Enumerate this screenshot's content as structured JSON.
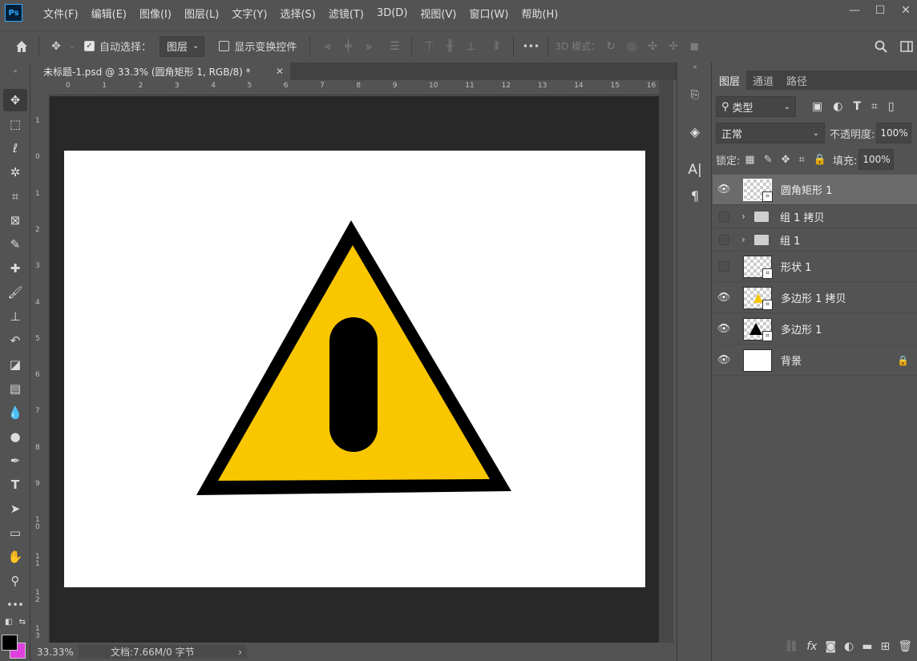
{
  "app": {
    "logo": "Ps"
  },
  "menu": [
    "文件(F)",
    "编辑(E)",
    "图像(I)",
    "图层(L)",
    "文字(Y)",
    "选择(S)",
    "滤镜(T)",
    "3D(D)",
    "视图(V)",
    "窗口(W)",
    "帮助(H)"
  ],
  "window_controls": {
    "minimize": "—",
    "maximize": "☐",
    "close": "✕"
  },
  "options": {
    "auto_select_label": "自动选择：",
    "auto_select_checked": true,
    "auto_select_target": "图层",
    "show_transform_label": "显示变换控件",
    "show_transform_checked": false,
    "more": "•••",
    "mode_3d_label": "3D 模式："
  },
  "document": {
    "tab_title": "未标题-1.psd @ 33.3% (圆角矩形 1, RGB/8) *",
    "colors": {
      "triangle_fill": "#f9c600",
      "triangle_stroke": "#000000",
      "pill": "#000000",
      "background": "#ffffff"
    }
  },
  "rulers": {
    "top": [
      "0",
      "1",
      "2",
      "3",
      "4",
      "5",
      "6",
      "7",
      "8",
      "9",
      "10",
      "11",
      "12",
      "13",
      "14",
      "15",
      "16"
    ],
    "left": [
      "1",
      "0",
      "1",
      "2",
      "3",
      "4",
      "5",
      "6",
      "7",
      "8",
      "9",
      "1 0",
      "1 1",
      "1 2",
      "1 3"
    ]
  },
  "status": {
    "zoom": "33.33%",
    "doc_info": "文档:7.66M/0 字节",
    "arrow": "›"
  },
  "layers_panel": {
    "tabs": [
      "图层",
      "通道",
      "路径"
    ],
    "active_tab": "图层",
    "filter": {
      "kind_label": "类型"
    },
    "blend_mode": "正常",
    "opacity_label": "不透明度:",
    "opacity_value": "100%",
    "lock_label": "锁定:",
    "fill_label": "填充:",
    "fill_value": "100%",
    "layers": [
      {
        "name": "圆角矩形 1",
        "visible": true,
        "selected": true,
        "type": "shape"
      },
      {
        "name": "组 1 拷贝",
        "visible": false,
        "selected": false,
        "type": "group"
      },
      {
        "name": "组 1",
        "visible": false,
        "selected": false,
        "type": "group"
      },
      {
        "name": "形状 1",
        "visible": false,
        "selected": false,
        "type": "shape"
      },
      {
        "name": "多边形 1 拷贝",
        "visible": true,
        "selected": false,
        "type": "shape"
      },
      {
        "name": "多边形 1",
        "visible": true,
        "selected": false,
        "type": "shape"
      },
      {
        "name": "背景",
        "visible": true,
        "selected": false,
        "type": "background",
        "locked": true
      }
    ]
  }
}
